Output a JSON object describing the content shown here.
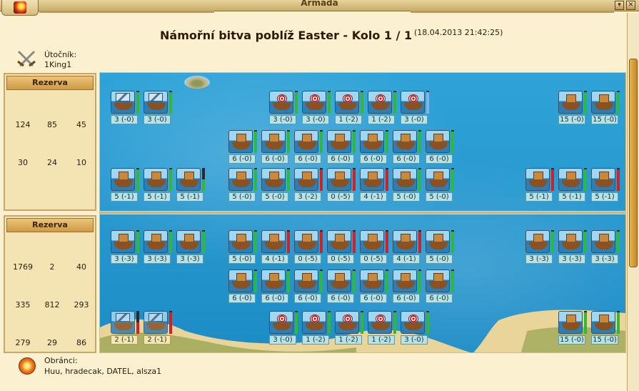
{
  "window": {
    "title": "Armada"
  },
  "battle": {
    "title": "Námořní bitva poblíž Easter - Kolo 1 / 1",
    "date": "(18.04.2013 21:42:25)"
  },
  "attacker": {
    "label": "Útočník:",
    "name": "1King1"
  },
  "defender": {
    "label": "Obránci:",
    "names": "Huu, hradecak, DATEL, alsza1"
  },
  "reserve_attacker": {
    "header": "Rezerva",
    "items": [
      {
        "icon": "ram-ship-icon",
        "count": "124"
      },
      {
        "icon": "ballista-ship-icon",
        "count": "85"
      },
      {
        "icon": "mortar-ship-icon",
        "count": "45"
      },
      {
        "icon": "paddle-ship-icon",
        "count": "30"
      },
      {
        "icon": "blade-ship-icon",
        "count": "24"
      },
      {
        "icon": "catapult-ship-icon",
        "count": "10"
      }
    ]
  },
  "reserve_defender": {
    "header": "Rezerva",
    "items": [
      {
        "icon": "ram-ship-icon",
        "count": "1769"
      },
      {
        "icon": "ballista-ship-icon",
        "count": "2"
      },
      {
        "icon": "catapult-ship-icon",
        "count": "40"
      },
      {
        "icon": "paddle-ship-icon",
        "count": "335"
      },
      {
        "icon": "ballista-ship-icon",
        "count": "812"
      },
      {
        "icon": "mortar-ship-icon",
        "count": "293"
      },
      {
        "icon": "paddle-ship-icon",
        "count": "279"
      },
      {
        "icon": "blade-ship-icon",
        "count": "29"
      },
      {
        "icon": "catapult-ship-icon",
        "count": "86"
      }
    ]
  },
  "colors": {
    "health_green": "#2fb83a",
    "health_red": "#d32020",
    "health_blue": "#7bb8e8"
  },
  "battlefield": {
    "attacker_rows": [
      {
        "units": [
          {
            "type": "blade-ship-icon",
            "label": "3 (-0)",
            "health": 0.95,
            "color": "#2fb83a"
          },
          {
            "type": "blade-ship-icon",
            "label": "3 (-0)",
            "health": 0.95,
            "color": "#2fb83a"
          },
          {
            "type": "mortar-ship-icon",
            "label": "3 (-0)",
            "health": 0.95,
            "color": "#2fb83a"
          },
          {
            "type": "mortar-ship-icon",
            "label": "3 (-0)",
            "health": 0.95,
            "color": "#2fb83a"
          },
          {
            "type": "mortar-ship-icon",
            "label": "1 (-2)",
            "health": 0.95,
            "color": "#2fb83a"
          },
          {
            "type": "mortar-ship-icon",
            "label": "1 (-2)",
            "health": 0.95,
            "color": "#2fb83a"
          },
          {
            "type": "mortar-ship-icon",
            "label": "3 (-0)",
            "health": 0.95,
            "color": "#7bb8e8"
          },
          {
            "type": "catapult-ship-icon",
            "label": "15 (-0)",
            "health": 0.95,
            "color": "#2fb83a"
          },
          {
            "type": "catapult-ship-icon",
            "label": "15 (-0)",
            "health": 0.95,
            "color": "#2fb83a"
          }
        ]
      },
      {
        "units": [
          {
            "type": "ballista-ship-icon",
            "label": "6 (-0)",
            "health": 0.95,
            "color": "#2fb83a"
          },
          {
            "type": "ballista-ship-icon",
            "label": "6 (-0)",
            "health": 0.95,
            "color": "#2fb83a"
          },
          {
            "type": "ballista-ship-icon",
            "label": "6 (-0)",
            "health": 0.95,
            "color": "#2fb83a"
          },
          {
            "type": "ballista-ship-icon",
            "label": "6 (-0)",
            "health": 0.95,
            "color": "#2fb83a"
          },
          {
            "type": "ballista-ship-icon",
            "label": "6 (-0)",
            "health": 0.95,
            "color": "#2fb83a"
          },
          {
            "type": "ballista-ship-icon",
            "label": "6 (-0)",
            "health": 0.95,
            "color": "#2fb83a"
          },
          {
            "type": "ballista-ship-icon",
            "label": "6 (-0)",
            "health": 0.95,
            "color": "#2fb83a"
          }
        ]
      },
      {
        "units": [
          {
            "type": "ram-ship-icon",
            "label": "5 (-1)",
            "health": 0.95,
            "color": "#2fb83a"
          },
          {
            "type": "ram-ship-icon",
            "label": "5 (-1)",
            "health": 0.95,
            "color": "#2fb83a"
          },
          {
            "type": "ram-ship-icon",
            "label": "5 (-1)",
            "health": 0.5,
            "color": "#2fb83a"
          },
          {
            "type": "paddle-ship-icon",
            "label": "5 (-0)",
            "health": 0.95,
            "color": "#2fb83a"
          },
          {
            "type": "paddle-ship-icon",
            "label": "5 (-0)",
            "health": 0.95,
            "color": "#2fb83a"
          },
          {
            "type": "paddle-ship-icon",
            "label": "3 (-2)",
            "health": 0.95,
            "color": "#d32020"
          },
          {
            "type": "paddle-ship-icon",
            "label": "0 (-5)",
            "health": 0.95,
            "color": "#d32020"
          },
          {
            "type": "paddle-ship-icon",
            "label": "4 (-1)",
            "health": 0.95,
            "color": "#d32020"
          },
          {
            "type": "paddle-ship-icon",
            "label": "5 (-0)",
            "health": 0.95,
            "color": "#2fb83a"
          },
          {
            "type": "paddle-ship-icon",
            "label": "5 (-0)",
            "health": 0.95,
            "color": "#2fb83a"
          },
          {
            "type": "ram-ship-icon",
            "label": "5 (-1)",
            "health": 0.95,
            "color": "#d32020"
          },
          {
            "type": "ram-ship-icon",
            "label": "5 (-1)",
            "health": 0.95,
            "color": "#2fb83a"
          },
          {
            "type": "ram-ship-icon",
            "label": "5 (-1)",
            "health": 0.95,
            "color": "#d32020"
          }
        ]
      }
    ],
    "defender_rows": [
      {
        "units": [
          {
            "type": "ram-ship-icon",
            "label": "3 (-3)",
            "health": 0.95,
            "color": "#2fb83a"
          },
          {
            "type": "ram-ship-icon",
            "label": "3 (-3)",
            "health": 0.95,
            "color": "#2fb83a"
          },
          {
            "type": "ram-ship-icon",
            "label": "3 (-3)",
            "health": 0.95,
            "color": "#2fb83a"
          },
          {
            "type": "paddle-ship-icon",
            "label": "5 (-0)",
            "health": 0.95,
            "color": "#2fb83a"
          },
          {
            "type": "paddle-ship-icon",
            "label": "4 (-1)",
            "health": 0.95,
            "color": "#d32020"
          },
          {
            "type": "paddle-ship-icon",
            "label": "0 (-5)",
            "health": 0.95,
            "color": "#d32020"
          },
          {
            "type": "paddle-ship-icon",
            "label": "0 (-5)",
            "health": 0.95,
            "color": "#d32020"
          },
          {
            "type": "paddle-ship-icon",
            "label": "0 (-5)",
            "health": 0.95,
            "color": "#d32020"
          },
          {
            "type": "paddle-ship-icon",
            "label": "4 (-1)",
            "health": 0.95,
            "color": "#d32020"
          },
          {
            "type": "paddle-ship-icon",
            "label": "5 (-0)",
            "health": 0.95,
            "color": "#2fb83a"
          },
          {
            "type": "ram-ship-icon",
            "label": "3 (-3)",
            "health": 0.95,
            "color": "#2fb83a"
          },
          {
            "type": "ram-ship-icon",
            "label": "3 (-3)",
            "health": 0.95,
            "color": "#2fb83a"
          },
          {
            "type": "ram-ship-icon",
            "label": "3 (-3)",
            "health": 0.95,
            "color": "#2fb83a"
          }
        ]
      },
      {
        "units": [
          {
            "type": "ballista-ship-icon",
            "label": "6 (-0)",
            "health": 0.95,
            "color": "#2fb83a"
          },
          {
            "type": "ballista-ship-icon",
            "label": "6 (-0)",
            "health": 0.95,
            "color": "#2fb83a"
          },
          {
            "type": "ballista-ship-icon",
            "label": "6 (-0)",
            "health": 0.95,
            "color": "#2fb83a"
          },
          {
            "type": "ballista-ship-icon",
            "label": "6 (-0)",
            "health": 0.95,
            "color": "#2fb83a"
          },
          {
            "type": "ballista-ship-icon",
            "label": "6 (-0)",
            "health": 0.95,
            "color": "#2fb83a"
          },
          {
            "type": "ballista-ship-icon",
            "label": "6 (-0)",
            "health": 0.95,
            "color": "#2fb83a"
          },
          {
            "type": "ballista-ship-icon",
            "label": "6 (-0)",
            "health": 0.95,
            "color": "#2fb83a"
          }
        ]
      },
      {
        "units": [
          {
            "type": "blade-ship-icon",
            "label": "2 (-1)",
            "health": 0.5,
            "color": "#d32020",
            "dim": true
          },
          {
            "type": "blade-ship-icon",
            "label": "2 (-1)",
            "health": 0.95,
            "color": "#d32020",
            "dim": true
          },
          {
            "type": "mortar-ship-icon",
            "label": "3 (-0)",
            "health": 0.95,
            "color": "#2fb83a"
          },
          {
            "type": "mortar-ship-icon",
            "label": "1 (-2)",
            "health": 0.95,
            "color": "#2fb83a"
          },
          {
            "type": "mortar-ship-icon",
            "label": "1 (-2)",
            "health": 0.95,
            "color": "#2fb83a"
          },
          {
            "type": "mortar-ship-icon",
            "label": "1 (-2)",
            "health": 0.95,
            "color": "#2fb83a"
          },
          {
            "type": "mortar-ship-icon",
            "label": "3 (-0)",
            "health": 0.95,
            "color": "#2fb83a"
          },
          {
            "type": "catapult-ship-icon",
            "label": "15 (-0)",
            "health": 0.95,
            "color": "#2fb83a"
          },
          {
            "type": "catapult-ship-icon",
            "label": "15 (-0)",
            "health": 0.95,
            "color": "#2fb83a"
          }
        ]
      }
    ]
  }
}
